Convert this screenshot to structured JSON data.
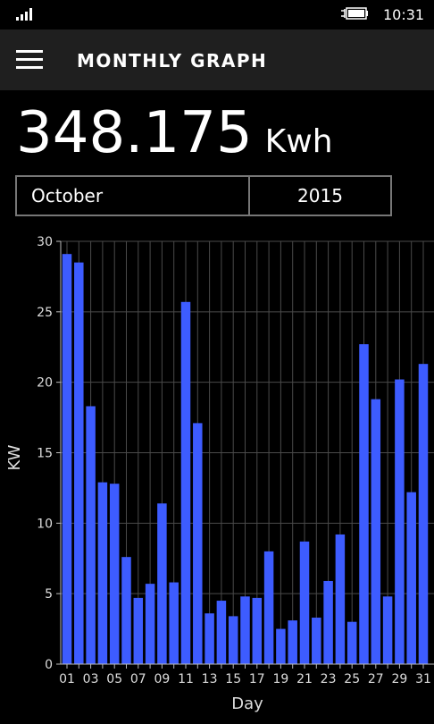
{
  "status": {
    "time": "10:31"
  },
  "header": {
    "title": "MONTHLY GRAPH"
  },
  "summary": {
    "total_value": "348.175",
    "total_unit": "Kwh"
  },
  "picker": {
    "month": "October",
    "year": "2015"
  },
  "colors": {
    "bar": "#3d5cff",
    "grid": "#4a4a4a",
    "axis": "#bbbbbb",
    "appbar": "#1f1f1f"
  },
  "icons": [
    "signal-icon",
    "battery-charging-icon",
    "menu-icon"
  ],
  "chart_data": {
    "type": "bar",
    "title": "",
    "xlabel": "Day",
    "ylabel": "KW",
    "ylim": [
      0,
      30
    ],
    "yticks": [
      0,
      5,
      10,
      15,
      20,
      25,
      30
    ],
    "grid": true,
    "categories": [
      "01",
      "02",
      "03",
      "04",
      "05",
      "06",
      "07",
      "08",
      "09",
      "10",
      "11",
      "12",
      "13",
      "14",
      "15",
      "16",
      "17",
      "18",
      "19",
      "20",
      "21",
      "22",
      "23",
      "24",
      "25",
      "26",
      "27",
      "28",
      "29",
      "30",
      "31"
    ],
    "xtick_labels": [
      "01",
      "03",
      "05",
      "07",
      "09",
      "11",
      "13",
      "15",
      "17",
      "19",
      "21",
      "23",
      "25",
      "27",
      "29",
      "31"
    ],
    "values": [
      29.1,
      28.5,
      18.3,
      12.9,
      12.8,
      7.6,
      4.7,
      5.7,
      11.4,
      5.8,
      25.7,
      17.1,
      3.6,
      4.5,
      3.4,
      4.8,
      4.7,
      8.0,
      2.5,
      3.1,
      8.7,
      3.3,
      5.9,
      9.2,
      3.0,
      22.7,
      18.8,
      4.8,
      20.2,
      12.2,
      21.3
    ]
  }
}
